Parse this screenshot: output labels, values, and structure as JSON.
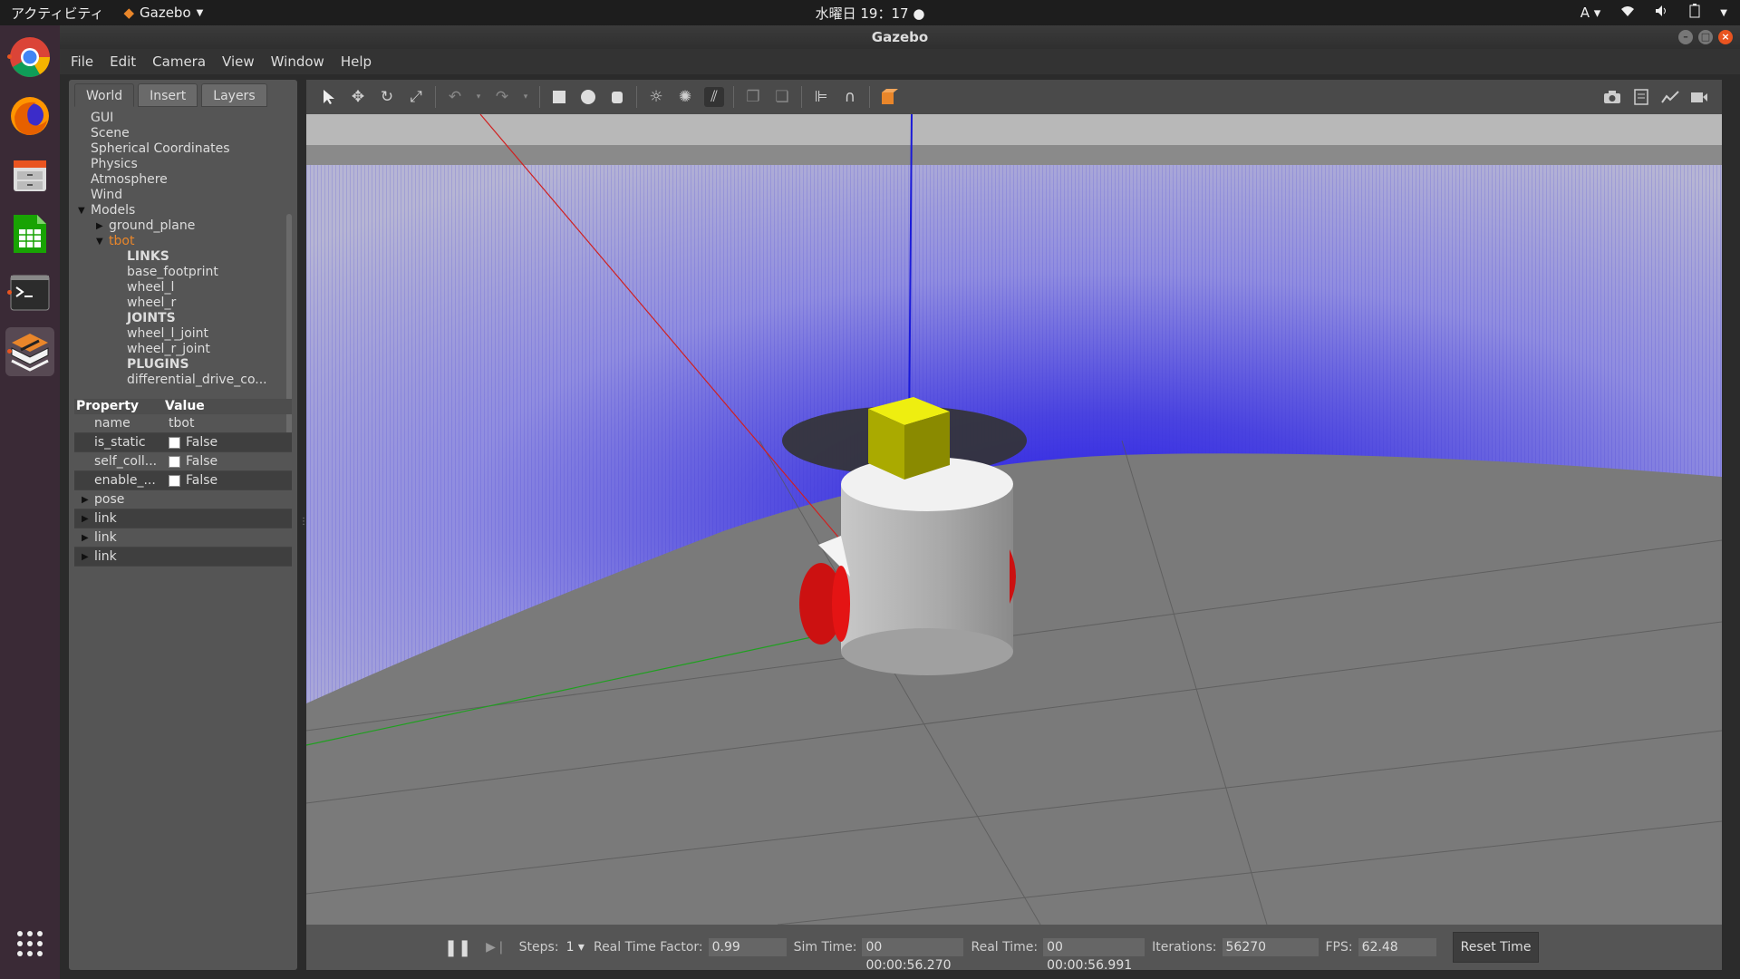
{
  "topbar": {
    "activities": "アクティビティ",
    "app_name": "Gazebo",
    "clock": "水曜日 19：17",
    "input_method": "A"
  },
  "window": {
    "title": "Gazebo"
  },
  "menu": [
    "File",
    "Edit",
    "Camera",
    "View",
    "Window",
    "Help"
  ],
  "tabs": [
    "World",
    "Insert",
    "Layers"
  ],
  "tree": [
    {
      "label": "GUI",
      "indent": 0,
      "toggle": ""
    },
    {
      "label": "Scene",
      "indent": 0,
      "toggle": ""
    },
    {
      "label": "Spherical Coordinates",
      "indent": 0,
      "toggle": ""
    },
    {
      "label": "Physics",
      "indent": 0,
      "toggle": ""
    },
    {
      "label": "Atmosphere",
      "indent": 0,
      "toggle": ""
    },
    {
      "label": "Wind",
      "indent": 0,
      "toggle": ""
    },
    {
      "label": "Models",
      "indent": 0,
      "toggle": "open"
    },
    {
      "label": "ground_plane",
      "indent": 1,
      "toggle": "closed"
    },
    {
      "label": "tbot",
      "indent": 1,
      "toggle": "open",
      "selected": true
    },
    {
      "label": "LINKS",
      "indent": 2,
      "toggle": "",
      "bold": true
    },
    {
      "label": "base_footprint",
      "indent": 2,
      "toggle": ""
    },
    {
      "label": "wheel_l",
      "indent": 2,
      "toggle": ""
    },
    {
      "label": "wheel_r",
      "indent": 2,
      "toggle": ""
    },
    {
      "label": "JOINTS",
      "indent": 2,
      "toggle": "",
      "bold": true
    },
    {
      "label": "wheel_l_joint",
      "indent": 2,
      "toggle": ""
    },
    {
      "label": "wheel_r_joint",
      "indent": 2,
      "toggle": ""
    },
    {
      "label": "PLUGINS",
      "indent": 2,
      "toggle": "",
      "bold": true
    },
    {
      "label": "differential_drive_co...",
      "indent": 2,
      "toggle": ""
    }
  ],
  "properties": {
    "header_property": "Property",
    "header_value": "Value",
    "rows": [
      {
        "key": "name",
        "value": "tbot",
        "checkbox": false
      },
      {
        "key": "is_static",
        "value": "False",
        "checkbox": true
      },
      {
        "key": "self_coll...",
        "value": "False",
        "checkbox": true
      },
      {
        "key": "enable_...",
        "value": "False",
        "checkbox": true
      }
    ],
    "expandables": [
      "pose",
      "link",
      "link",
      "link"
    ]
  },
  "bottombar": {
    "steps_label": "Steps:",
    "steps_value": "1",
    "rtf_label": "Real Time Factor:",
    "rtf_value": "0.99",
    "sim_time_label": "Sim Time:",
    "sim_time_value": "00 00:00:56.270",
    "real_time_label": "Real Time:",
    "real_time_value": "00 00:00:56.991",
    "iterations_label": "Iterations:",
    "iterations_value": "56270",
    "fps_label": "FPS:",
    "fps_value": "62.48",
    "reset_label": "Reset Time"
  },
  "colors": {
    "accent": "#e95420",
    "selected_tree": "#e9862a",
    "laser": "#2a1fe6",
    "wheel": "#cc1010",
    "sensor_box": "#d8d800"
  }
}
